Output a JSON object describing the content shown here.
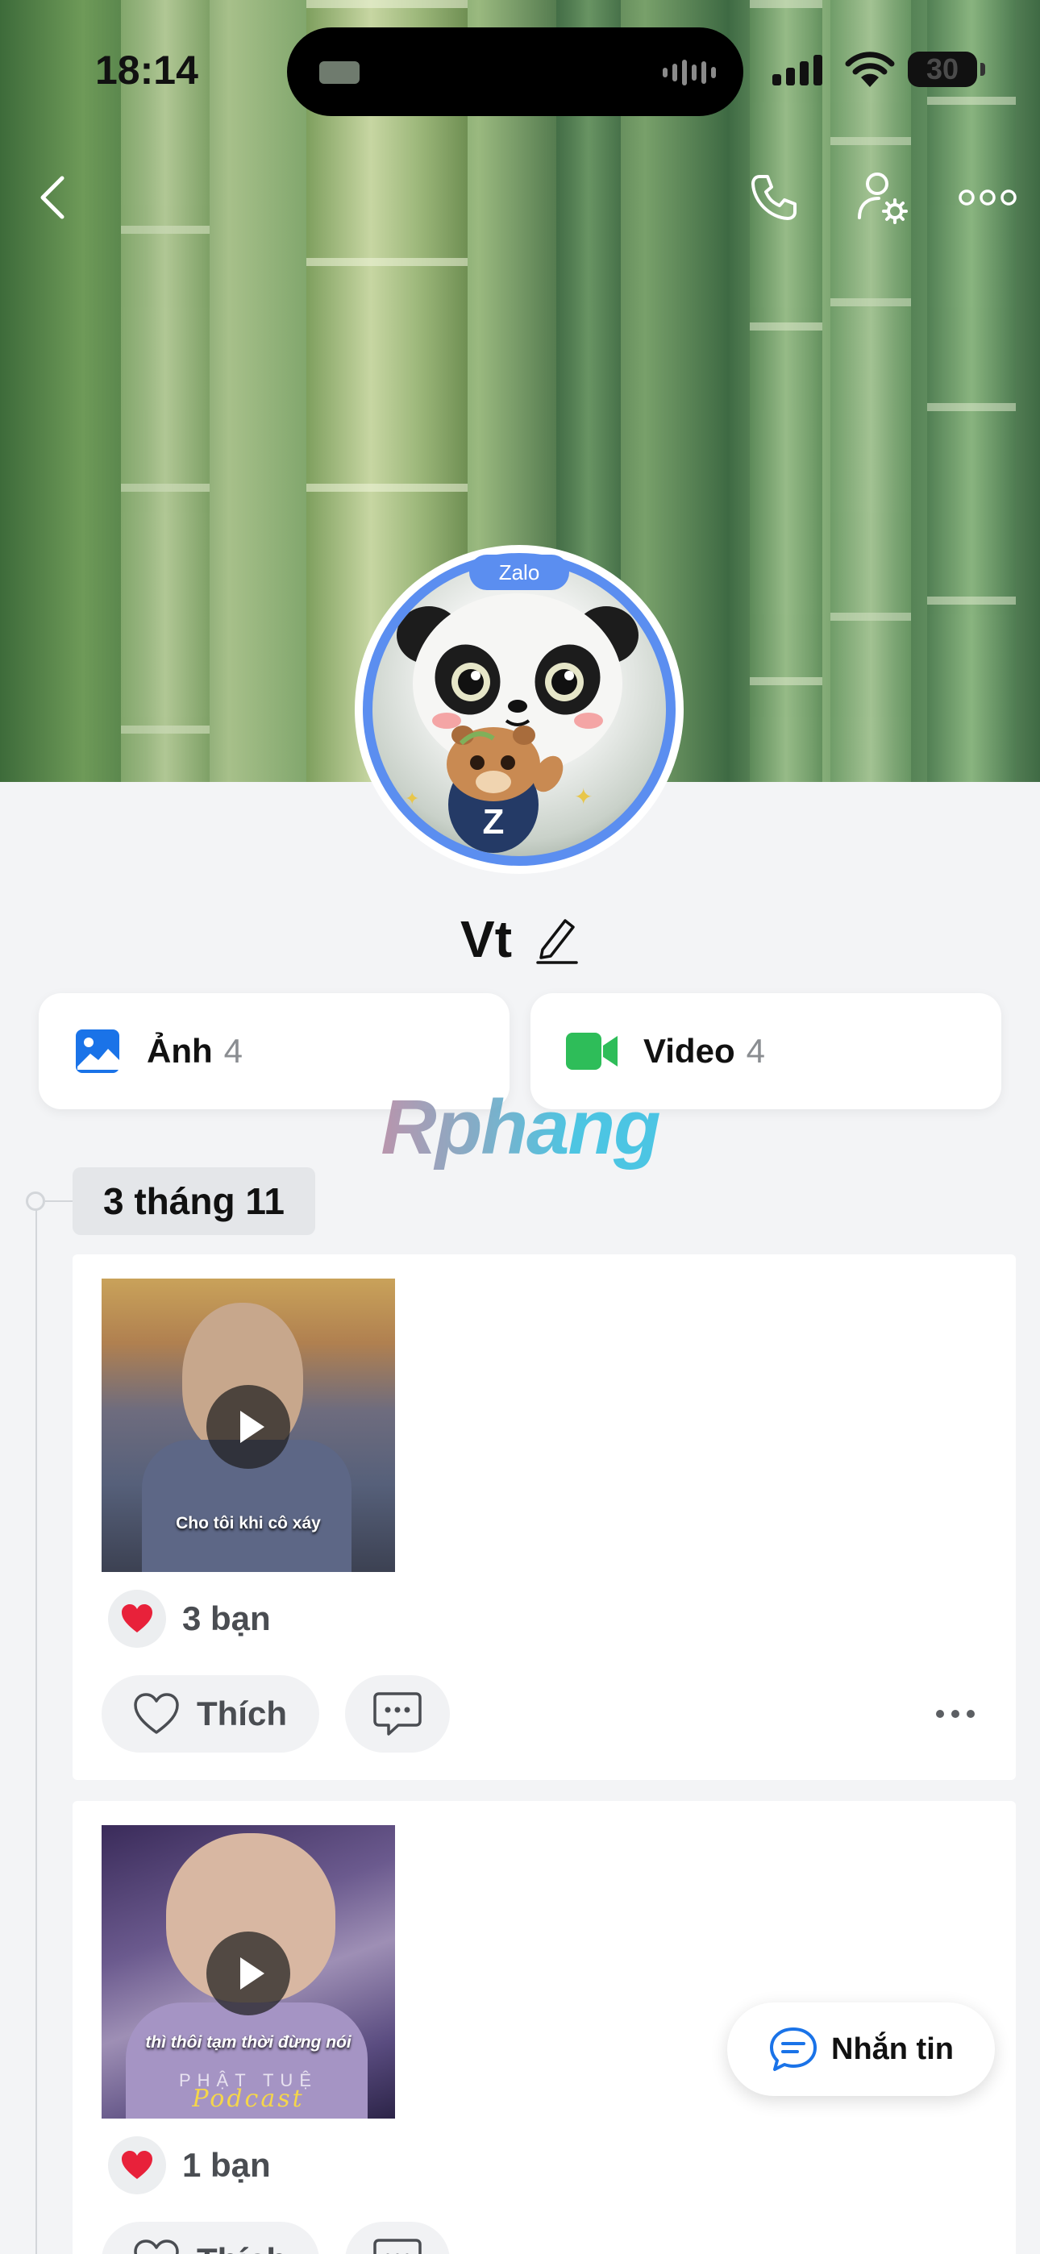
{
  "status_bar": {
    "time": "18:14",
    "battery": "30"
  },
  "header": {
    "icons": [
      "chevron-left-icon",
      "phone-icon",
      "user-settings-icon",
      "more-horizontal-icon"
    ]
  },
  "profile": {
    "avatar_badge": "Zalo",
    "name": "Vt"
  },
  "media": {
    "photos_label": "Ảnh",
    "photos_count": "4",
    "videos_label": "Video",
    "videos_count": "4",
    "photos_icon_color": "#1a73e8",
    "videos_icon_color": "#2ebd59"
  },
  "watermark": "Rphang",
  "timeline": {
    "date": "3 tháng 11",
    "posts": [
      {
        "video_caption": "Cho tôi khi cô xáy",
        "reactions": "3 bạn",
        "like_label": "Thích"
      },
      {
        "video_caption": "thì thôi tạm thời đừng nói",
        "video_brand": "PHẬT TUỆ",
        "video_brand_script": "Podcast",
        "reactions": "1 bạn",
        "like_label": "Thích"
      }
    ]
  },
  "message_button": {
    "label": "Nhắn tin",
    "color": "#1a73e8"
  }
}
